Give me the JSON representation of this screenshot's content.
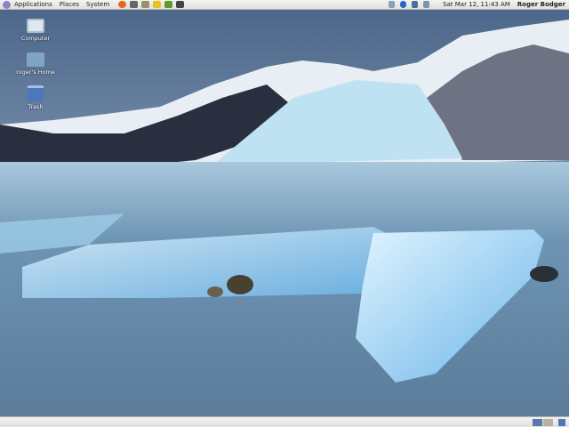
{
  "top_panel": {
    "menus": [
      "Applications",
      "Places",
      "System"
    ],
    "launchers": [
      {
        "icon": "firefox-icon",
        "color": "#e66a1a"
      },
      {
        "icon": "screenshot-icon",
        "color": "#666"
      },
      {
        "icon": "network-tools-icon",
        "color": "#9a8f6a"
      },
      {
        "icon": "text-editor-icon",
        "color": "#e8c21a"
      },
      {
        "icon": "image-viewer-icon",
        "color": "#5c9a2c"
      },
      {
        "icon": "terminal-icon",
        "color": "#444"
      }
    ],
    "tray": [
      {
        "icon": "volume-icon",
        "color": "#8aa0b8"
      },
      {
        "icon": "bluetooth-icon",
        "color": "#2a64c8"
      },
      {
        "icon": "network-signal-icon",
        "color": "#4a6ea0"
      },
      {
        "icon": "battery-icon",
        "color": "#7a94b4"
      }
    ],
    "clock": "Sat Mar 12, 11:43 AM",
    "user": "Roger Bodger"
  },
  "desktop_icons": [
    {
      "label": "Computer",
      "icon": "computer-icon"
    },
    {
      "label": "roger's Home",
      "icon": "home-folder-icon"
    },
    {
      "label": "Trash",
      "icon": "trash-icon"
    }
  ],
  "bottom_panel": {
    "workspaces": [
      {
        "active": true,
        "color": "#5878b0"
      },
      {
        "active": false,
        "color": "#b8b0a8"
      }
    ],
    "trash_icon": "trash-applet-icon"
  }
}
